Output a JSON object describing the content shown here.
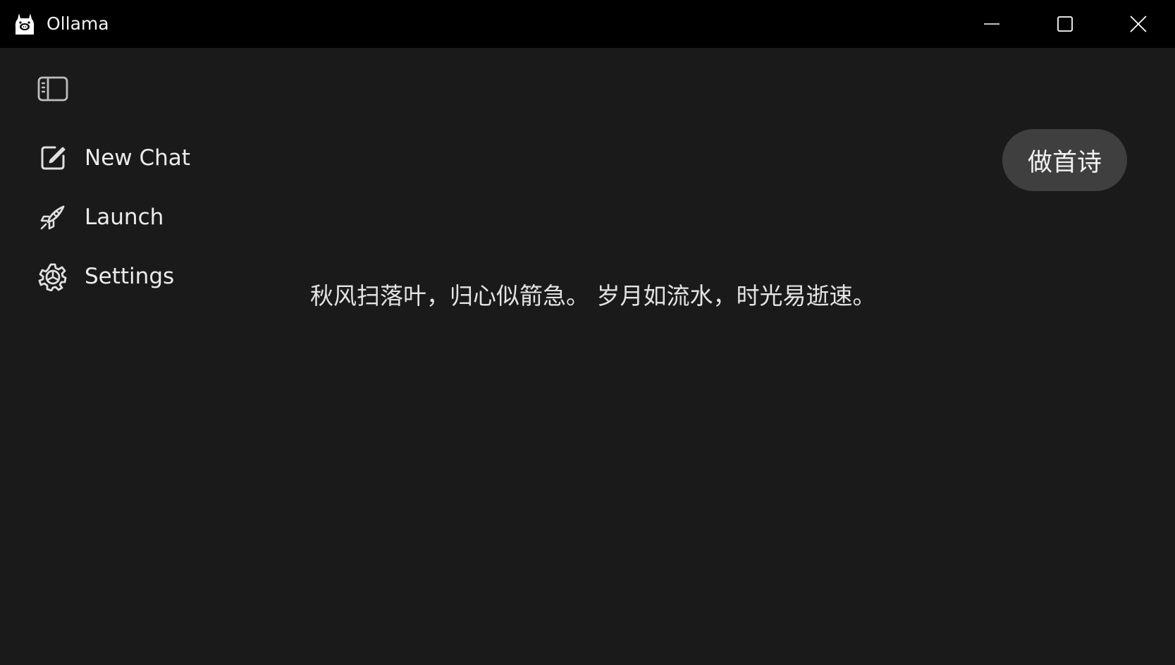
{
  "window": {
    "title": "Ollama",
    "logo_icon": "ollama-llama-icon",
    "controls": {
      "minimize_icon": "minimize-icon",
      "maximize_icon": "maximize-icon",
      "close_icon": "close-icon"
    }
  },
  "sidebar": {
    "toggle_icon": "sidebar-toggle-icon",
    "items": [
      {
        "label": "New Chat",
        "icon": "edit-square-icon"
      },
      {
        "label": "Launch",
        "icon": "rocket-icon"
      },
      {
        "label": "Settings",
        "icon": "gear-icon"
      }
    ]
  },
  "chat": {
    "messages": [
      {
        "role": "user",
        "text": "做首诗"
      },
      {
        "role": "assistant",
        "text": "秋风扫落叶，归心似箭急。 岁月如流水，时光易逝速。"
      }
    ]
  },
  "colors": {
    "titlebar_bg": "#000000",
    "content_bg": "#1a1a1a",
    "bubble_bg": "#3f3f3f",
    "text": "#ececec"
  }
}
